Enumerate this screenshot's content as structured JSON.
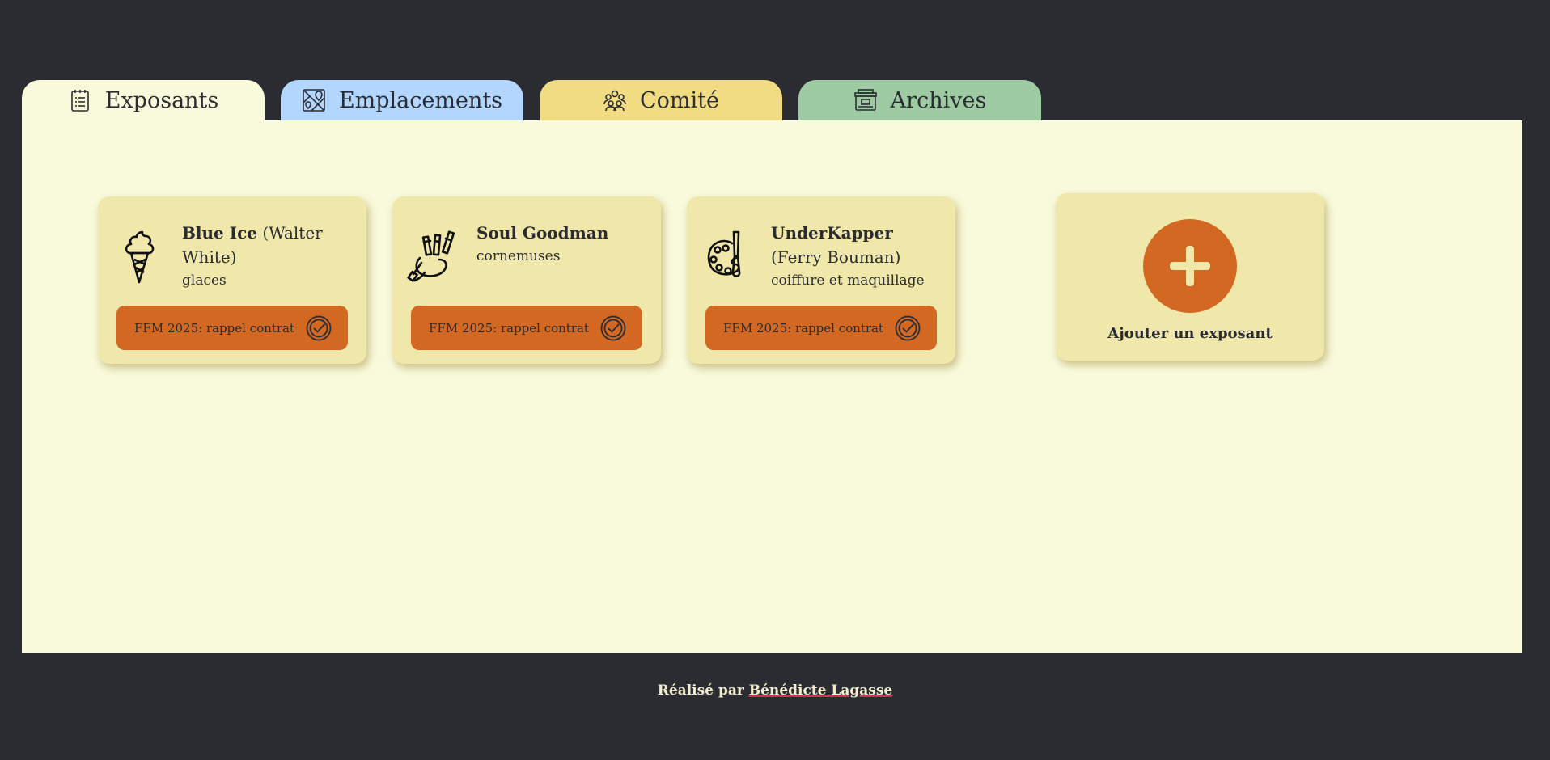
{
  "tabs": [
    {
      "label": "Exposants",
      "icon": "clipboard-list-icon",
      "color": "#f8fadb"
    },
    {
      "label": "Emplacements",
      "icon": "map-icon",
      "color": "#b3d6ff"
    },
    {
      "label": "Comité",
      "icon": "people-group-icon",
      "color": "#f1dc84"
    },
    {
      "label": "Archives",
      "icon": "archive-box-icon",
      "color": "#9fcba4"
    }
  ],
  "exhibitors": [
    {
      "name": "Blue Ice",
      "contact": "(Walter White)",
      "category": "glaces",
      "icon": "ice-cream-icon",
      "reminder": "FFM 2025: rappel contrat"
    },
    {
      "name": "Soul Goodman",
      "contact": "",
      "category": "cornemuses",
      "icon": "bagpipe-icon",
      "reminder": "FFM 2025: rappel contrat"
    },
    {
      "name": "UnderKapper",
      "contact": "(Ferry Bouman)",
      "category": "coiffure et maquillage",
      "icon": "palette-icon",
      "reminder": "FFM 2025: rappel contrat"
    }
  ],
  "add_card": {
    "label": "Ajouter un exposant"
  },
  "footer": {
    "prefix": "Réalisé par",
    "author": "Bénédicte Lagasse"
  },
  "colors": {
    "background": "#2b2c31",
    "panel": "#f8fadb",
    "card": "#f0e8aa",
    "accent": "#d26822",
    "footer_link_underline": "#d1324b"
  }
}
